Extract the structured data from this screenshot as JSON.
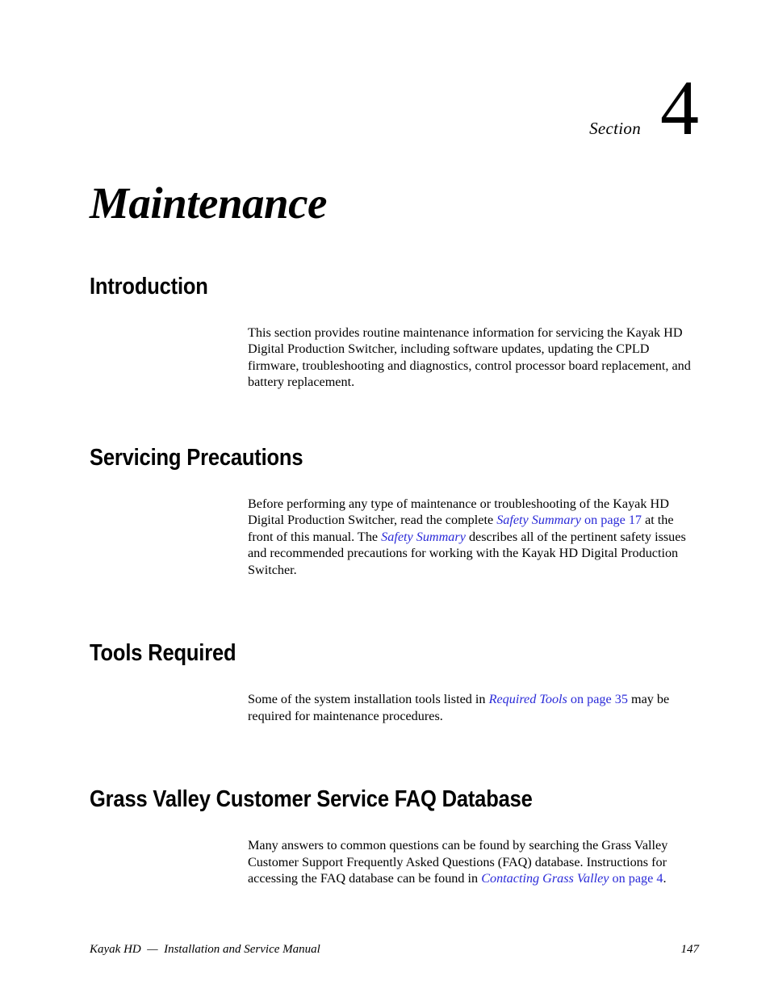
{
  "document": {
    "section_label": "Section",
    "section_number": "4",
    "chapter_title": "Maintenance"
  },
  "sections": {
    "introduction": {
      "heading": "Introduction",
      "paragraph": "This section provides routine maintenance information for servicing the Kayak HD Digital Production Switcher, including software updates, updating the CPLD firmware, troubleshooting and diagnostics, control processor board replacement, and battery replacement."
    },
    "servicing_precautions": {
      "heading": "Servicing Precautions",
      "text_1": "Before performing any type of maintenance or troubleshooting of the Kayak HD Digital Production Switcher, read the complete ",
      "link_1_title": "Safety Summary",
      "link_1_page": " on page 17",
      "text_2": " at the front of this manual. The ",
      "link_2_title": "Safety Summary",
      "text_3": " describes all of the pertinent safety issues and recommended precautions for working with the Kayak HD Digital Production Switcher."
    },
    "tools_required": {
      "heading": "Tools Required",
      "text_1": "Some of the system installation tools listed in ",
      "link_1_title": "Required Tools",
      "link_1_page": " on page 35",
      "text_2": " may be required for maintenance procedures."
    },
    "faq_database": {
      "heading": "Grass Valley Customer Service FAQ Database",
      "text_1": "Many answers to common questions can be found by searching the Grass Valley Customer Support Frequently Asked Questions (FAQ) database. Instructions for accessing the FAQ database can be found in ",
      "link_1_title": "Contacting Grass Valley",
      "link_1_page": " on page 4",
      "text_2": "."
    }
  },
  "footer": {
    "manual_title": "Kayak HD  —  Installation and Service Manual",
    "page_number": "147"
  },
  "colors": {
    "link_blue": "#2a2ad8",
    "text_black": "#000000",
    "page_background": "#ffffff"
  }
}
